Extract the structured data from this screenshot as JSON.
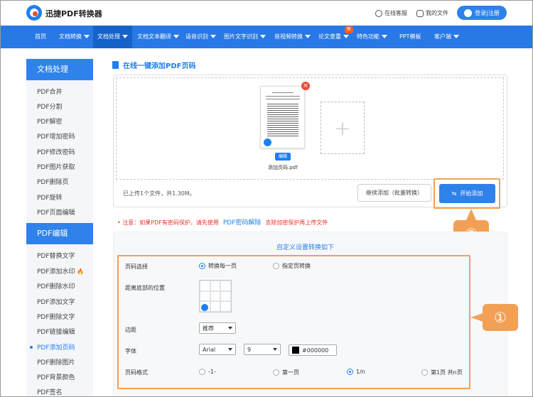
{
  "header": {
    "brand": "迅捷PDF转换器",
    "service": "在线客服",
    "my_files": "我的文件",
    "login": "登录|注册"
  },
  "nav": {
    "items": [
      "首页",
      "文档转换",
      "文档处理",
      "文档文本翻译",
      "语音识别",
      "图片文字识别",
      "音视频转换",
      "论文查重",
      "特色功能",
      "PPT模板",
      "客户端"
    ],
    "new_badge": "新"
  },
  "sidebar": {
    "section1": "文档处理",
    "items1": [
      "PDF合并",
      "PDF分割",
      "PDF解密",
      "PDF增加密码",
      "PDF修改密码",
      "PDF图片获取",
      "PDF删除页",
      "PDF旋转",
      "PDF页面编辑"
    ],
    "section2": "PDF编辑",
    "items2": [
      "PDF替换文字",
      "PDF添加水印",
      "PDF删除水印",
      "PDF添加文字",
      "PDF删除文字",
      "PDF链接编辑",
      "PDF添加页码",
      "PDF删除图片",
      "PDF背景颜色",
      "PDF签名"
    ]
  },
  "main": {
    "title": "在线一键添加PDF页码",
    "edit_label": "编辑",
    "file_name": "添加页码.pdf",
    "uploaded_info": "已上传1个文件，共1.30M。",
    "continue_button": "继续添加（批量转换）",
    "start_button": "开始添加",
    "notice_prefix": "• 注意：如果PDF有密码保护，请先使用",
    "notice_link": "PDF密码解除",
    "notice_suffix": "去除加密保护再上传文件",
    "callout_1": "①",
    "callout_2": "②"
  },
  "settings": {
    "title": "自定义设置转换如下",
    "page_select_label": "页码选择",
    "page_select_opt1": "转换每一页",
    "page_select_opt2": "指定页转换",
    "position_label": "距离底部的位置",
    "margin_label": "边距",
    "margin_value": "推荐",
    "font_label": "字体",
    "font_family_value": "Arial",
    "font_size_value": "9",
    "font_color_value": "#000000",
    "format_label": "页码格式",
    "format_opt1": "-1-",
    "format_opt2": "第一页",
    "format_opt3": "1/n",
    "format_opt4": "第1页 共n页"
  },
  "colors": {
    "accent": "#2f82ea",
    "highlight": "#f2a055",
    "warning": "#e8332c"
  }
}
